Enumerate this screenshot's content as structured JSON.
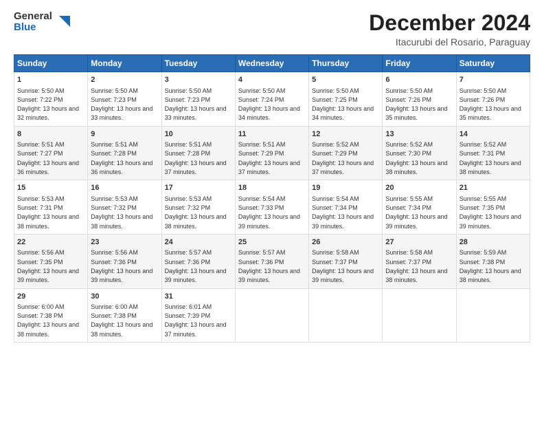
{
  "header": {
    "logo_general": "General",
    "logo_blue": "Blue",
    "title": "December 2024",
    "subtitle": "Itacurubi del Rosario, Paraguay"
  },
  "days_of_week": [
    "Sunday",
    "Monday",
    "Tuesday",
    "Wednesday",
    "Thursday",
    "Friday",
    "Saturday"
  ],
  "weeks": [
    [
      {
        "day": "1",
        "sunrise": "Sunrise: 5:50 AM",
        "sunset": "Sunset: 7:22 PM",
        "daylight": "Daylight: 13 hours and 32 minutes."
      },
      {
        "day": "2",
        "sunrise": "Sunrise: 5:50 AM",
        "sunset": "Sunset: 7:23 PM",
        "daylight": "Daylight: 13 hours and 33 minutes."
      },
      {
        "day": "3",
        "sunrise": "Sunrise: 5:50 AM",
        "sunset": "Sunset: 7:23 PM",
        "daylight": "Daylight: 13 hours and 33 minutes."
      },
      {
        "day": "4",
        "sunrise": "Sunrise: 5:50 AM",
        "sunset": "Sunset: 7:24 PM",
        "daylight": "Daylight: 13 hours and 34 minutes."
      },
      {
        "day": "5",
        "sunrise": "Sunrise: 5:50 AM",
        "sunset": "Sunset: 7:25 PM",
        "daylight": "Daylight: 13 hours and 34 minutes."
      },
      {
        "day": "6",
        "sunrise": "Sunrise: 5:50 AM",
        "sunset": "Sunset: 7:26 PM",
        "daylight": "Daylight: 13 hours and 35 minutes."
      },
      {
        "day": "7",
        "sunrise": "Sunrise: 5:50 AM",
        "sunset": "Sunset: 7:26 PM",
        "daylight": "Daylight: 13 hours and 35 minutes."
      }
    ],
    [
      {
        "day": "8",
        "sunrise": "Sunrise: 5:51 AM",
        "sunset": "Sunset: 7:27 PM",
        "daylight": "Daylight: 13 hours and 36 minutes."
      },
      {
        "day": "9",
        "sunrise": "Sunrise: 5:51 AM",
        "sunset": "Sunset: 7:28 PM",
        "daylight": "Daylight: 13 hours and 36 minutes."
      },
      {
        "day": "10",
        "sunrise": "Sunrise: 5:51 AM",
        "sunset": "Sunset: 7:28 PM",
        "daylight": "Daylight: 13 hours and 37 minutes."
      },
      {
        "day": "11",
        "sunrise": "Sunrise: 5:51 AM",
        "sunset": "Sunset: 7:29 PM",
        "daylight": "Daylight: 13 hours and 37 minutes."
      },
      {
        "day": "12",
        "sunrise": "Sunrise: 5:52 AM",
        "sunset": "Sunset: 7:29 PM",
        "daylight": "Daylight: 13 hours and 37 minutes."
      },
      {
        "day": "13",
        "sunrise": "Sunrise: 5:52 AM",
        "sunset": "Sunset: 7:30 PM",
        "daylight": "Daylight: 13 hours and 38 minutes."
      },
      {
        "day": "14",
        "sunrise": "Sunrise: 5:52 AM",
        "sunset": "Sunset: 7:31 PM",
        "daylight": "Daylight: 13 hours and 38 minutes."
      }
    ],
    [
      {
        "day": "15",
        "sunrise": "Sunrise: 5:53 AM",
        "sunset": "Sunset: 7:31 PM",
        "daylight": "Daylight: 13 hours and 38 minutes."
      },
      {
        "day": "16",
        "sunrise": "Sunrise: 5:53 AM",
        "sunset": "Sunset: 7:32 PM",
        "daylight": "Daylight: 13 hours and 38 minutes."
      },
      {
        "day": "17",
        "sunrise": "Sunrise: 5:53 AM",
        "sunset": "Sunset: 7:32 PM",
        "daylight": "Daylight: 13 hours and 38 minutes."
      },
      {
        "day": "18",
        "sunrise": "Sunrise: 5:54 AM",
        "sunset": "Sunset: 7:33 PM",
        "daylight": "Daylight: 13 hours and 39 minutes."
      },
      {
        "day": "19",
        "sunrise": "Sunrise: 5:54 AM",
        "sunset": "Sunset: 7:34 PM",
        "daylight": "Daylight: 13 hours and 39 minutes."
      },
      {
        "day": "20",
        "sunrise": "Sunrise: 5:55 AM",
        "sunset": "Sunset: 7:34 PM",
        "daylight": "Daylight: 13 hours and 39 minutes."
      },
      {
        "day": "21",
        "sunrise": "Sunrise: 5:55 AM",
        "sunset": "Sunset: 7:35 PM",
        "daylight": "Daylight: 13 hours and 39 minutes."
      }
    ],
    [
      {
        "day": "22",
        "sunrise": "Sunrise: 5:56 AM",
        "sunset": "Sunset: 7:35 PM",
        "daylight": "Daylight: 13 hours and 39 minutes."
      },
      {
        "day": "23",
        "sunrise": "Sunrise: 5:56 AM",
        "sunset": "Sunset: 7:36 PM",
        "daylight": "Daylight: 13 hours and 39 minutes."
      },
      {
        "day": "24",
        "sunrise": "Sunrise: 5:57 AM",
        "sunset": "Sunset: 7:36 PM",
        "daylight": "Daylight: 13 hours and 39 minutes."
      },
      {
        "day": "25",
        "sunrise": "Sunrise: 5:57 AM",
        "sunset": "Sunset: 7:36 PM",
        "daylight": "Daylight: 13 hours and 39 minutes."
      },
      {
        "day": "26",
        "sunrise": "Sunrise: 5:58 AM",
        "sunset": "Sunset: 7:37 PM",
        "daylight": "Daylight: 13 hours and 39 minutes."
      },
      {
        "day": "27",
        "sunrise": "Sunrise: 5:58 AM",
        "sunset": "Sunset: 7:37 PM",
        "daylight": "Daylight: 13 hours and 38 minutes."
      },
      {
        "day": "28",
        "sunrise": "Sunrise: 5:59 AM",
        "sunset": "Sunset: 7:38 PM",
        "daylight": "Daylight: 13 hours and 38 minutes."
      }
    ],
    [
      {
        "day": "29",
        "sunrise": "Sunrise: 6:00 AM",
        "sunset": "Sunset: 7:38 PM",
        "daylight": "Daylight: 13 hours and 38 minutes."
      },
      {
        "day": "30",
        "sunrise": "Sunrise: 6:00 AM",
        "sunset": "Sunset: 7:38 PM",
        "daylight": "Daylight: 13 hours and 38 minutes."
      },
      {
        "day": "31",
        "sunrise": "Sunrise: 6:01 AM",
        "sunset": "Sunset: 7:39 PM",
        "daylight": "Daylight: 13 hours and 37 minutes."
      },
      null,
      null,
      null,
      null
    ]
  ]
}
